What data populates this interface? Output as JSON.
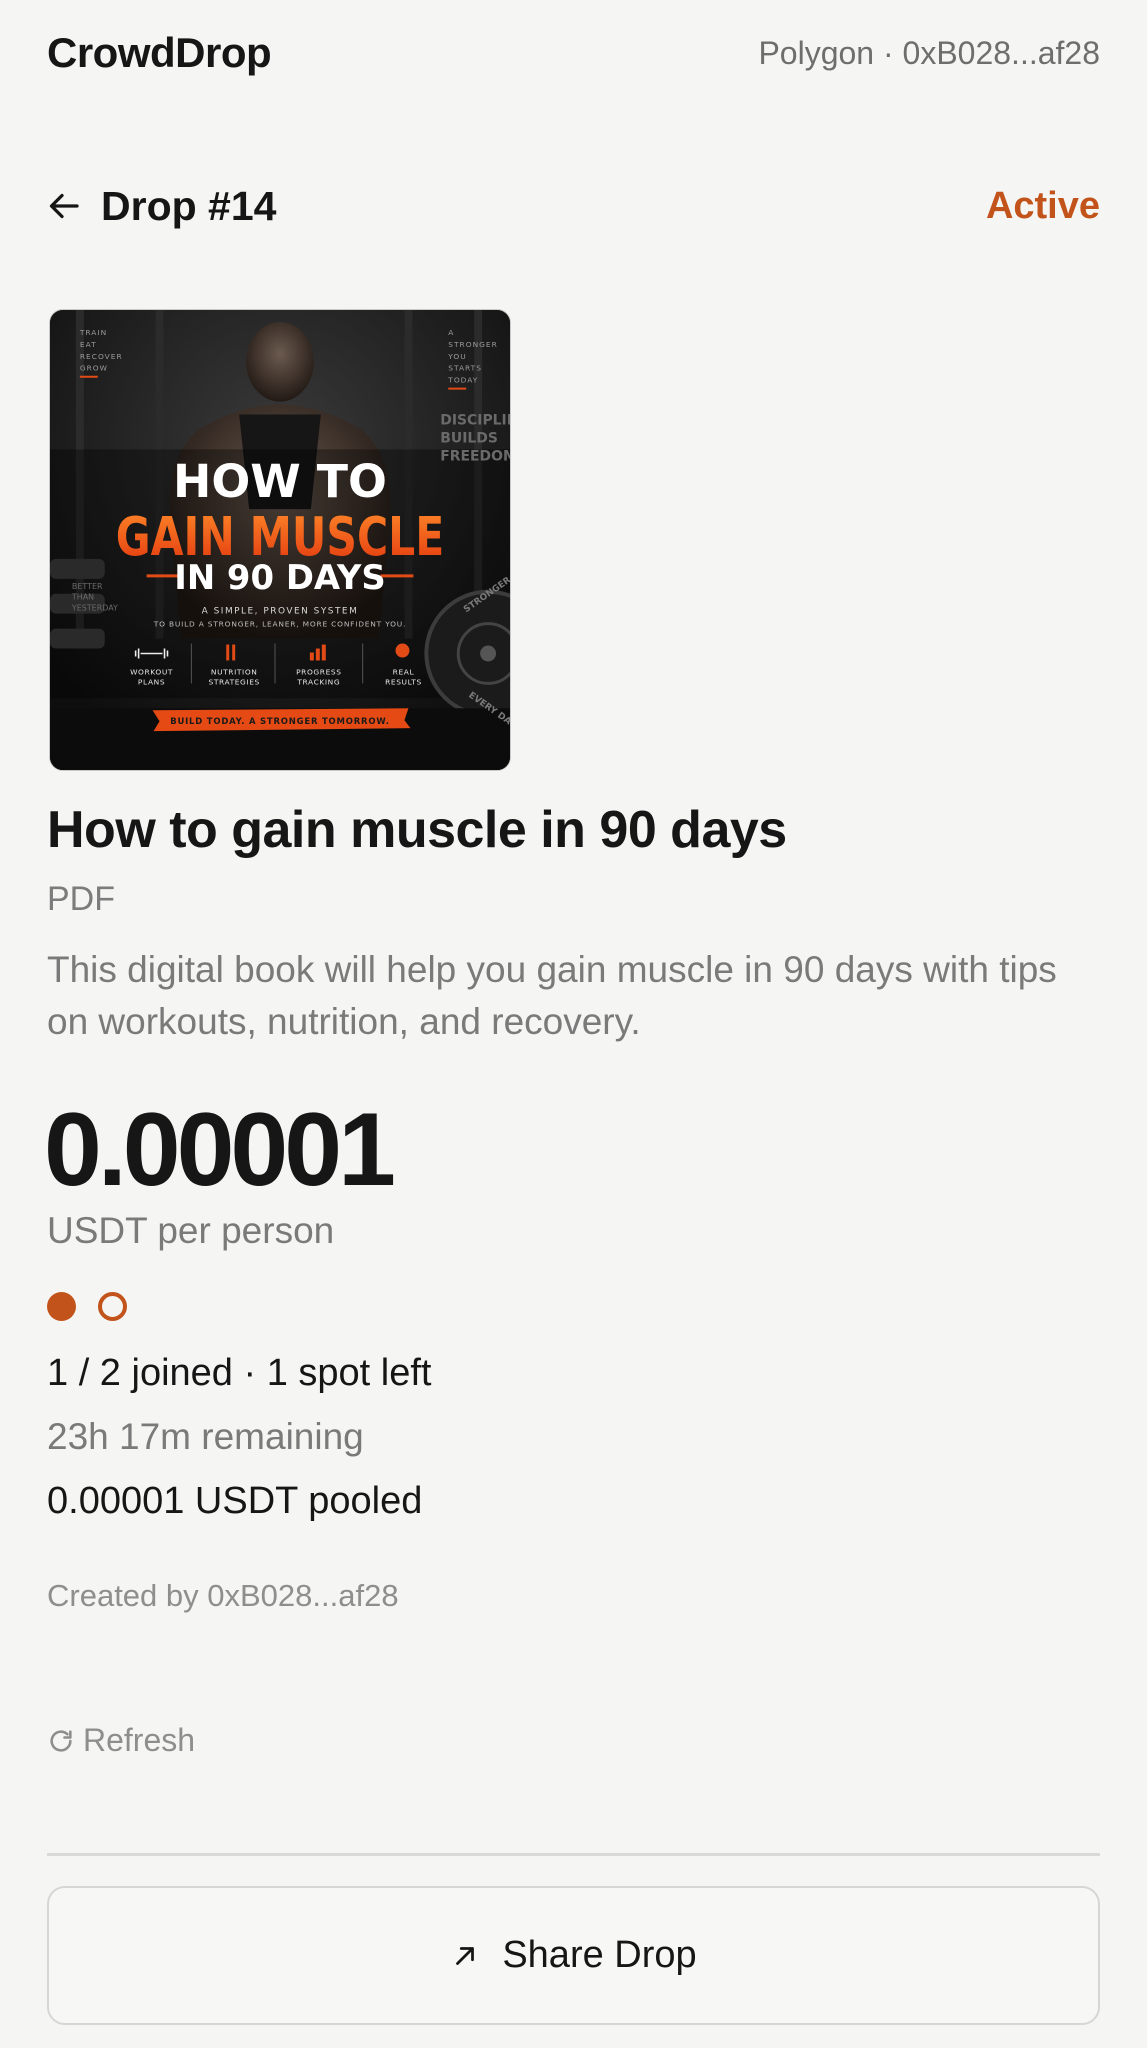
{
  "app": {
    "name": "CrowdDrop",
    "network": "Polygon · 0xB028...af28"
  },
  "header": {
    "title": "Drop #14",
    "status": "Active"
  },
  "cover": {
    "side_left": [
      "TRAIN",
      "EAT",
      "RECOVER",
      "GROW"
    ],
    "side_right": [
      "A",
      "STRONGER",
      "YOU",
      "STARTS",
      "TODAY"
    ],
    "poster_sign": [
      "DISCIPLINE",
      "BUILDS",
      "FREEDOM"
    ],
    "small_sign": [
      "BETTER",
      "THAN",
      "YESTERDAY"
    ],
    "heading1": "HOW TO",
    "heading2": "GAIN MUSCLE",
    "heading3": "IN 90 DAYS",
    "tag1": "A SIMPLE, PROVEN SYSTEM",
    "tag2": "TO BUILD A STRONGER, LEANER, MORE CONFIDENT YOU.",
    "features": [
      [
        "WORKOUT",
        "PLANS"
      ],
      [
        "NUTRITION",
        "STRATEGIES"
      ],
      [
        "PROGRESS",
        "TRACKING"
      ],
      [
        "REAL",
        "RESULTS"
      ]
    ],
    "plate_text_1": "STRONGER",
    "plate_text_2": "EVERY DAY",
    "banner": "BUILD TODAY. A STRONGER TOMORROW."
  },
  "product": {
    "title": "How to gain muscle in 90 days",
    "format": "PDF",
    "description": "This digital book will help you gain muscle in 90 days with tips on workouts, nutrition, and recovery."
  },
  "pricing": {
    "amount": "0.00001",
    "unit": "USDT per person"
  },
  "participation": {
    "slots_filled": 1,
    "slots_total": 2,
    "joined_text": "1 / 2 joined · 1 spot left",
    "remaining_text": "23h 17m remaining",
    "pooled_text": "0.00001 USDT pooled"
  },
  "creator": "Created by 0xB028...af28",
  "actions": {
    "refresh_label": "Refresh",
    "share_label": "Share Drop"
  },
  "colors": {
    "accent": "#c2531a",
    "background": "#f5f5f4",
    "text": "#161616",
    "muted": "#7a7a7a"
  },
  "icons": {
    "back": "arrow-left-icon",
    "refresh": "refresh-icon",
    "share": "arrow-up-right-icon"
  }
}
